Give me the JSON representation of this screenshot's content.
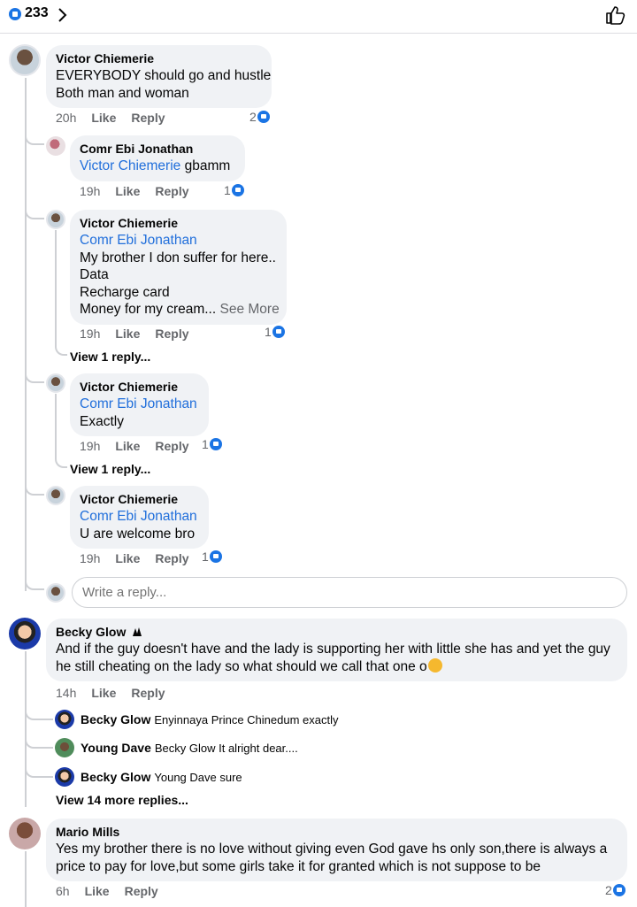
{
  "header": {
    "reaction_count": "233"
  },
  "comments": [
    {
      "author": "Victor Chiemerie",
      "lines": [
        "EVERYBODY should go and hustle",
        "Both man and woman"
      ],
      "time": "20h",
      "like": "Like",
      "reply": "Reply",
      "reactions": "2"
    }
  ],
  "replies": [
    {
      "author": "Comr Ebi Jonathan",
      "mention": "Victor Chiemerie",
      "text": "gbamm",
      "time": "19h",
      "like": "Like",
      "reply": "Reply",
      "reactions": "1"
    },
    {
      "author": "Victor Chiemerie",
      "mention": "Comr Ebi Jonathan",
      "lines": [
        "My brother I don suffer for here..",
        "Data",
        "Recharge card",
        "Money for my cream..."
      ],
      "see_more": "See More",
      "time": "19h",
      "like": "Like",
      "reply": "Reply",
      "reactions": "1",
      "view_replies": "View 1 reply..."
    },
    {
      "author": "Victor Chiemerie",
      "mention": "Comr Ebi Jonathan",
      "text": "Exactly",
      "time": "19h",
      "like": "Like",
      "reply": "Reply",
      "reactions": "1",
      "view_replies": "View 1 reply..."
    },
    {
      "author": "Victor Chiemerie",
      "mention": "Comr Ebi Jonathan",
      "text": "U are welcome bro",
      "time": "19h",
      "like": "Like",
      "reply": "Reply",
      "reactions": "1"
    }
  ],
  "reply_box": {
    "placeholder": "Write a reply..."
  },
  "becky": {
    "author": "Becky Glow",
    "lines": [
      "And if the guy doesn't have and the lady is supporting her with little she has and yet the guy",
      "he still cheating on the lady so what should we call that one o"
    ],
    "time": "14h",
    "like": "Like",
    "reply": "Reply",
    "mini_replies": [
      {
        "author": "Becky Glow",
        "text": "Enyinnaya Prince Chinedum exactly"
      },
      {
        "author": "Young Dave",
        "text": "Becky Glow It alright dear...."
      },
      {
        "author": "Becky Glow",
        "text": "Young Dave sure"
      }
    ],
    "view_more": "View 14 more replies..."
  },
  "mario": {
    "author": "Mario Mills",
    "lines": [
      "Yes my brother there is no love without giving even God gave hs only son,there is always a",
      "price to pay for love,but some girls take it for granted which is not suppose to be"
    ],
    "time": "6h",
    "like": "Like",
    "reply": "Reply",
    "reactions": "2"
  },
  "colors": {
    "accent": "#1b74e4",
    "mention": "#216fdb",
    "bubble": "#f0f2f5",
    "meta": "#65676b"
  },
  "icons": [
    "like-badge-icon",
    "chevron-right-icon",
    "thumbs-up-icon"
  ]
}
